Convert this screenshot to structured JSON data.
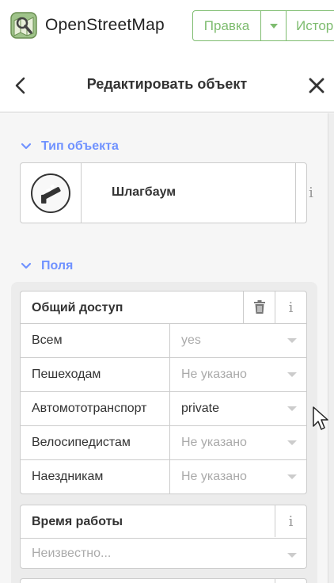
{
  "header": {
    "brand": "OpenStreetMap",
    "edit_label": "Правка",
    "history_label": "Истор",
    "colors": {
      "accent": "#7ebc6f"
    }
  },
  "panel": {
    "title": "Редактировать объект",
    "back_icon": "chevron-left-icon",
    "close_icon": "close-icon"
  },
  "preset_section": {
    "heading": "Тип объекта",
    "preset_name": "Шлагбаум",
    "preset_icon": "barrier-gate-icon",
    "info_label": "i"
  },
  "fields_section": {
    "heading": "Поля",
    "access": {
      "label": "Общий доступ",
      "delete_icon": "trash-icon",
      "info_label": "i",
      "rows": [
        {
          "label": "Всем",
          "value": "yes",
          "is_set": false
        },
        {
          "label": "Пешеходам",
          "value": "Не указано",
          "is_set": false
        },
        {
          "label": "Автомототранспорт",
          "value": "private",
          "is_set": true
        },
        {
          "label": "Велосипедистам",
          "value": "Не указано",
          "is_set": false
        },
        {
          "label": "Наездникам",
          "value": "Не указано",
          "is_set": false
        }
      ]
    },
    "opening_hours": {
      "label": "Время работы",
      "info_label": "i",
      "placeholder": "Неизвестно..."
    }
  },
  "colors": {
    "section_heading": "#7092ff",
    "border": "#cccccc",
    "panel_bg": "#f6f6f6"
  }
}
